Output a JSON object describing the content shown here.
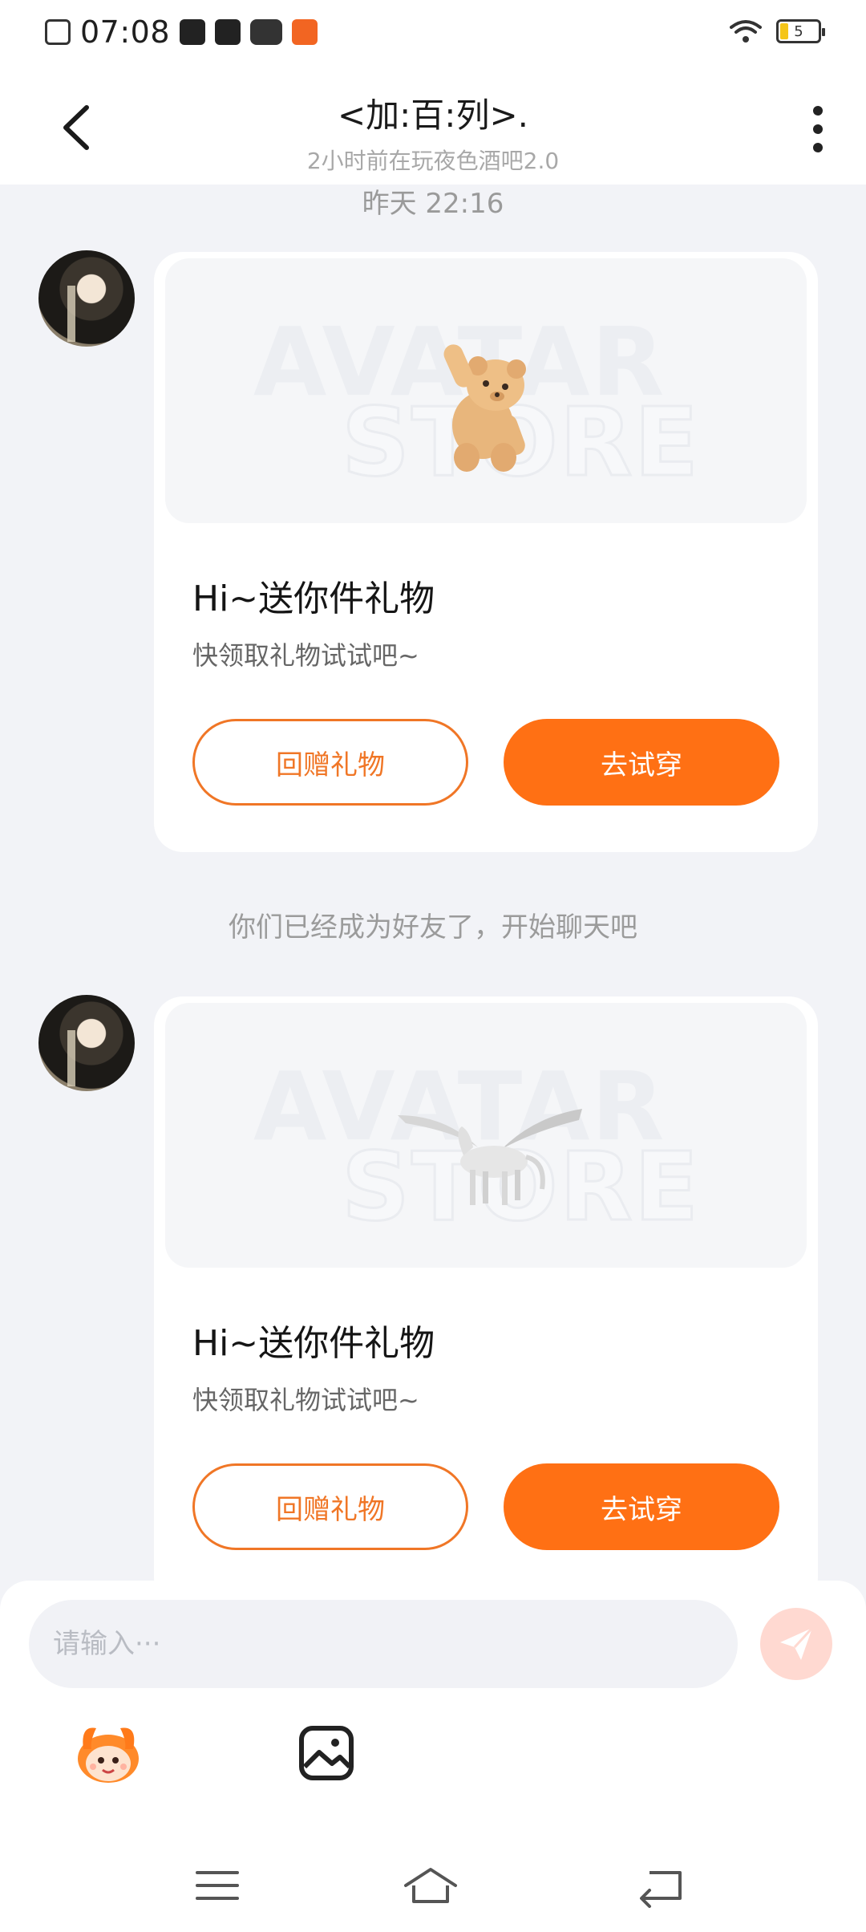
{
  "status_bar": {
    "time": "07:08",
    "battery": "5"
  },
  "header": {
    "title": "<加:百:列>.",
    "subtitle": "2小时前在玩夜色酒吧2.0"
  },
  "chat": {
    "timestamp": "昨天 22:16",
    "system_message": "你们已经成为好友了，开始聊天吧",
    "gift_cards": [
      {
        "watermark_line1": "AVATAR",
        "watermark_line2": "STORE",
        "item_icon": "teddy-bear-icon",
        "title": "Hi~送你件礼物",
        "subtitle": "快领取礼物试试吧~",
        "return_gift_label": "回赠礼物",
        "try_on_label": "去试穿"
      },
      {
        "watermark_line1": "AVATAR",
        "watermark_line2": "STORE",
        "item_icon": "pegasus-icon",
        "title": "Hi~送你件礼物",
        "subtitle": "快领取礼物试试吧~",
        "return_gift_label": "回赠礼物",
        "try_on_label": "去试穿"
      }
    ]
  },
  "composer": {
    "placeholder": "请输入···"
  },
  "colors": {
    "accent": "#ff7014",
    "accent_outline": "#f07626",
    "background": "#f2f3f7"
  }
}
